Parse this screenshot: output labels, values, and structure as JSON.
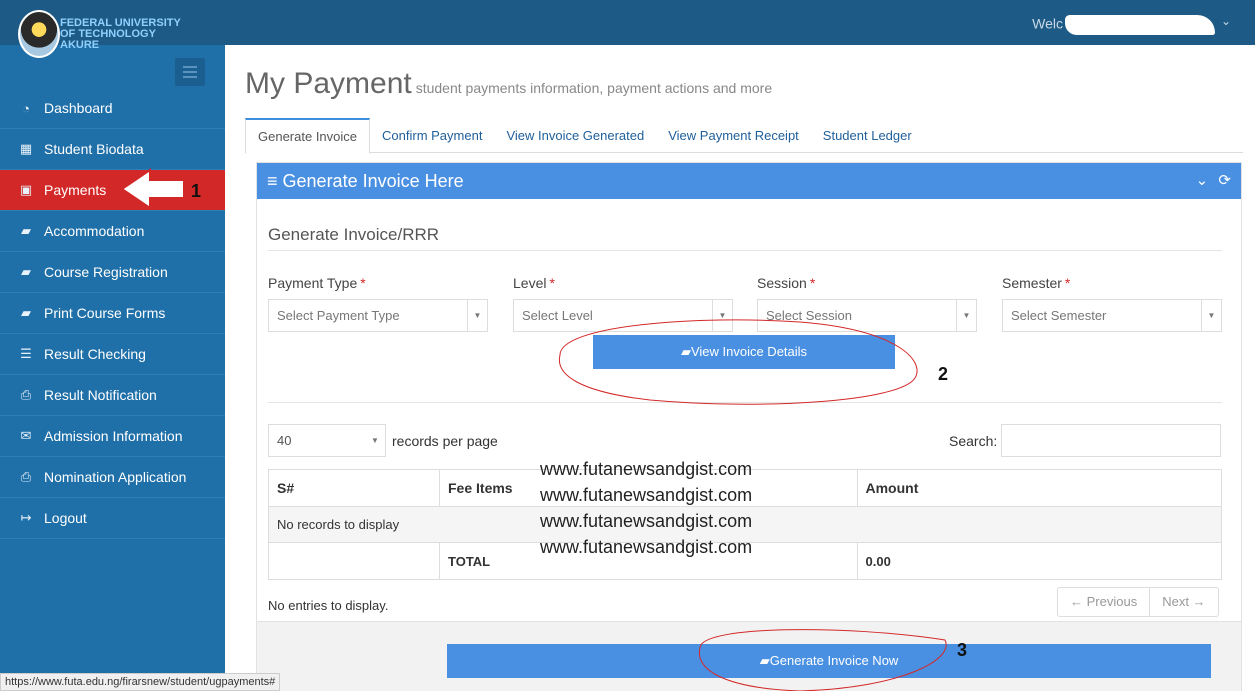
{
  "header": {
    "brand_line1": "FEDERAL UNIVERSITY",
    "brand_line2": "OF TECHNOLOGY",
    "brand_line3": "AKURE",
    "welcome": "Welc"
  },
  "sidebar": {
    "items": [
      {
        "label": "Dashboard",
        "icon": "dashboard-icon"
      },
      {
        "label": "Student Biodata",
        "icon": "table-icon"
      },
      {
        "label": "Payments",
        "icon": "money-icon"
      },
      {
        "label": "Accommodation",
        "icon": "book-icon"
      },
      {
        "label": "Course Registration",
        "icon": "book-icon"
      },
      {
        "label": "Print Course Forms",
        "icon": "book-icon"
      },
      {
        "label": "Result Checking",
        "icon": "list-icon"
      },
      {
        "label": "Result Notification",
        "icon": "print-icon"
      },
      {
        "label": "Admission Information",
        "icon": "envelope-icon"
      },
      {
        "label": "Nomination Application",
        "icon": "print-icon"
      },
      {
        "label": "Logout",
        "icon": "sign-out-icon"
      }
    ]
  },
  "page": {
    "title": "My Payment",
    "subtitle": "student payments information, payment actions and more"
  },
  "tabs": [
    "Generate Invoice",
    "Confirm Payment",
    "View Invoice Generated",
    "View Payment Receipt",
    "Student Ledger"
  ],
  "panel": {
    "heading": "Generate Invoice Here",
    "section_title": "Generate Invoice/RRR",
    "fields": [
      {
        "label": "Payment Type",
        "placeholder": "Select Payment Type"
      },
      {
        "label": "Level",
        "placeholder": "Select Level"
      },
      {
        "label": "Session",
        "placeholder": "Select Session"
      },
      {
        "label": "Semester",
        "placeholder": "Select Semester"
      }
    ],
    "view_button": "View Invoice Details",
    "records_value": "40",
    "records_label": "records per page",
    "search_label": "Search:",
    "table": {
      "headers": [
        "S#",
        "Fee Items",
        "",
        "Amount"
      ],
      "empty_text": "No records to display",
      "total_label": "TOTAL",
      "total_value": "0.00"
    },
    "entries_text": "No entries to display.",
    "prev_label": "← Previous",
    "next_label": "Next →",
    "generate_button": "Generate Invoice Now"
  },
  "watermark": [
    "www.futanewsandgist.com",
    "www.futanewsandgist.com",
    "www.futanewsandgist.com",
    "www.futanewsandgist.com"
  ],
  "annotations": [
    "1",
    "2",
    "3"
  ],
  "statusbar": "https://www.futa.edu.ng/firarsnew/student/ugpayments#"
}
